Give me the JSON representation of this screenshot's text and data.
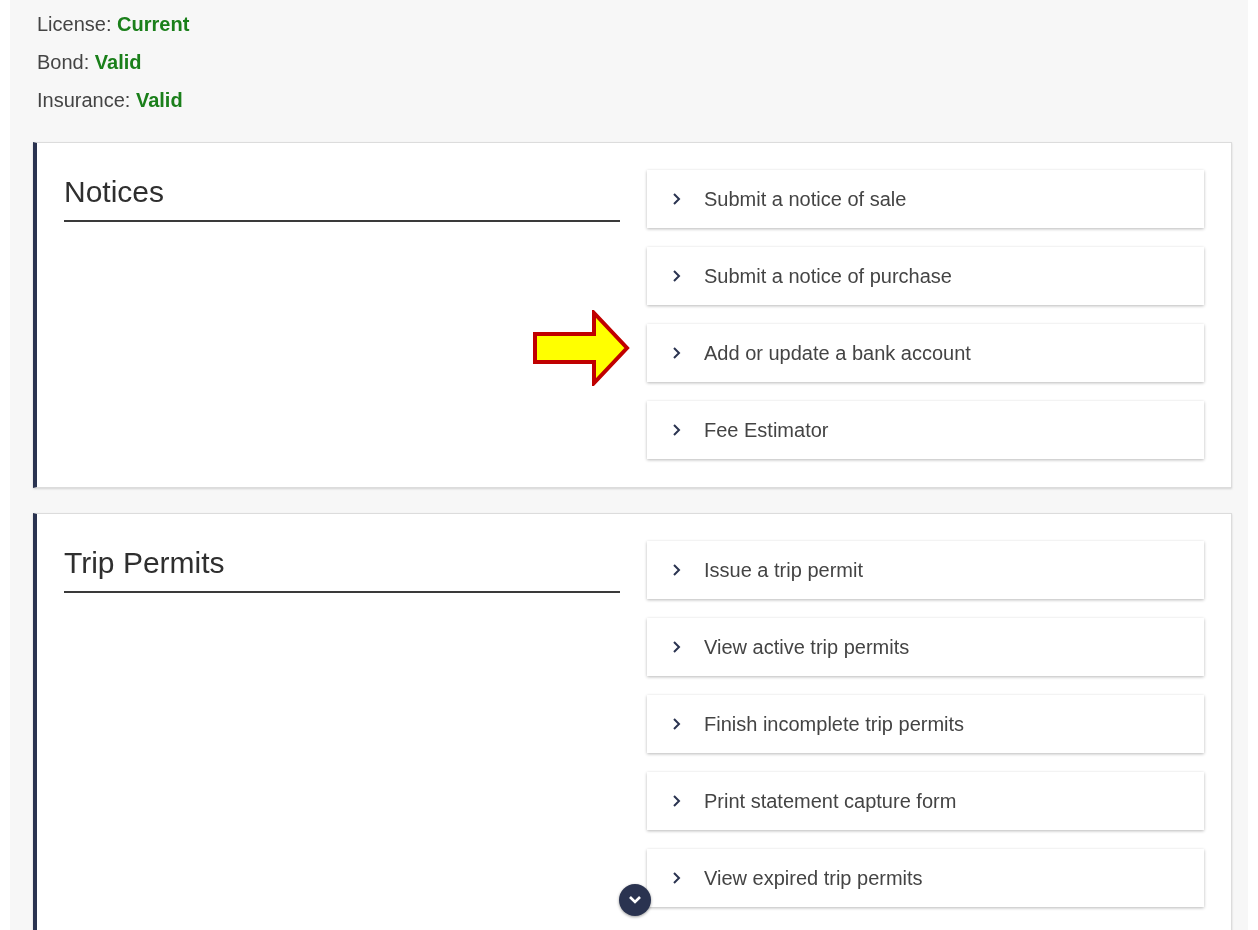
{
  "status": [
    {
      "label": "License:",
      "value": "Current"
    },
    {
      "label": "Bond:",
      "value": "Valid"
    },
    {
      "label": "Insurance:",
      "value": "Valid"
    }
  ],
  "sections": [
    {
      "title": "Notices",
      "links": [
        {
          "label": "Submit a notice of sale",
          "marked": false
        },
        {
          "label": "Submit a notice of purchase",
          "marked": false
        },
        {
          "label": "Add or update a bank account",
          "marked": true
        },
        {
          "label": "Fee Estimator",
          "marked": false
        }
      ]
    },
    {
      "title": "Trip Permits",
      "links": [
        {
          "label": "Issue a trip permit",
          "marked": false
        },
        {
          "label": "View active trip permits",
          "marked": false
        },
        {
          "label": "Finish incomplete trip permits",
          "marked": false
        },
        {
          "label": "Print statement capture form",
          "marked": false
        },
        {
          "label": "View expired trip permits",
          "marked": false
        }
      ]
    }
  ],
  "scroll_down_button": true
}
